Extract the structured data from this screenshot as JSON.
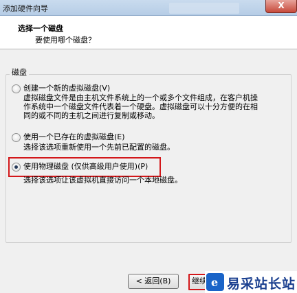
{
  "window": {
    "title": "添加硬件向导",
    "close_glyph": "X"
  },
  "header": {
    "title": "选择一个磁盘",
    "subtitle": "要使用哪个磁盘？"
  },
  "group": {
    "legend": "磁盘"
  },
  "options": [
    {
      "label": "创建一个新的虚拟磁盘(V)",
      "desc_lines": [
        "虚拟磁盘文件是由主机文件系统上的一个或多个文件组成，在客户机操",
        "作系统中一个磁盘文件代表着一个硬盘。虚拟磁盘可以十分方便的在相",
        "同的或不同的主机之间进行复制或移动。"
      ],
      "selected": false
    },
    {
      "label": "使用一个已存在的虚拟磁盘(E)",
      "desc_lines": [
        "选择该选项重新使用一个先前已配置的磁盘。"
      ],
      "selected": false
    },
    {
      "label": "使用物理磁盘 (仅供高级用户使用)(P)",
      "desc_lines": [
        "选择该选项让该虚拟机直接访问一个本地磁盘。"
      ],
      "selected": true
    }
  ],
  "buttons": {
    "back": "< 返回(B)",
    "next": "继续"
  },
  "watermark": {
    "logo_letter": "e",
    "text": "易采站长站"
  }
}
